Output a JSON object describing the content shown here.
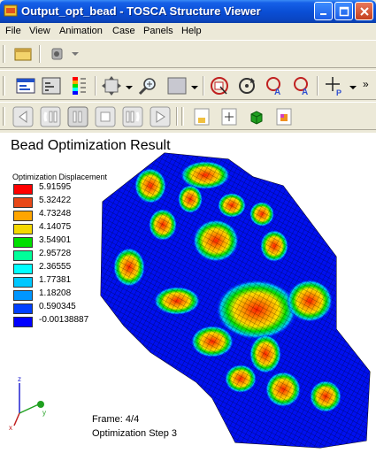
{
  "window": {
    "title": "Output_opt_bead - TOSCA Structure Viewer"
  },
  "menu": {
    "items": [
      "File",
      "View",
      "Animation",
      "Case",
      "Panels",
      "Help"
    ]
  },
  "toolbar": {
    "row1": [
      "open-model-icon",
      "camera-icon"
    ],
    "row2": [
      "legend-panel-icon",
      "deformation-icon",
      "color-scale-icon",
      "fit-view-icon",
      "zoom-icon",
      "display-mode-icon",
      "select-icon",
      "rotate-icon",
      "pick-a-icon",
      "pick-a2-icon",
      "probe-p-icon"
    ],
    "row3": [
      "first-frame-icon",
      "step-back-icon",
      "pause-icon",
      "stop-icon",
      "step-forward-icon",
      "play-icon",
      "cut-plane-icon",
      "section-icon",
      "box-icon",
      "color-box-icon"
    ],
    "overflow": "»"
  },
  "viewport": {
    "title": "Bead Optimization Result",
    "legend": {
      "title": "Optimization Displacement",
      "entries": [
        {
          "value": "5.91595",
          "color": "#ff0000"
        },
        {
          "value": "5.32422",
          "color": "#e84818"
        },
        {
          "value": "4.73248",
          "color": "#ffa500"
        },
        {
          "value": "4.14075",
          "color": "#f5d800"
        },
        {
          "value": "3.54901",
          "color": "#00e000"
        },
        {
          "value": "2.95728",
          "color": "#00ff99"
        },
        {
          "value": "2.36555",
          "color": "#00ffff"
        },
        {
          "value": "1.77381",
          "color": "#00c8ff"
        },
        {
          "value": "1.18208",
          "color": "#0096ff"
        },
        {
          "value": "0.590345",
          "color": "#0040ff"
        },
        {
          "value": "-0.00138887",
          "color": "#0000ff"
        }
      ]
    },
    "frame": "Frame: 4/4",
    "step": "Optimization Step  3",
    "axes": [
      "x",
      "y",
      "z"
    ]
  }
}
